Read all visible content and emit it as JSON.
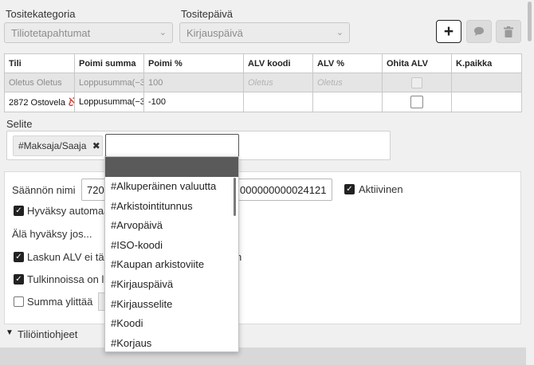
{
  "category": {
    "label": "Tositekategoria",
    "value": "Tiliotetapahtumat"
  },
  "date": {
    "label": "Tositepäivä",
    "value": "Kirjauspäivä"
  },
  "table": {
    "headers": [
      "Tili",
      "Poimi summa",
      "Poimi %",
      "ALV koodi",
      "ALV %",
      "Ohita ALV",
      "K.paikka"
    ],
    "row1": {
      "tili": "Oletus Oletus",
      "summa": "Loppusumma(−3",
      "pct": "100",
      "alv_koodi": "Oletus",
      "alv_pct": "Oletus"
    },
    "row2": {
      "tili": "2872 Ostovela",
      "summa": "Loppusumma(−3",
      "pct": "-100"
    }
  },
  "selite": {
    "label": "Selite",
    "tag": "#Maksaja/Saaja",
    "input_value": ""
  },
  "rule": {
    "name_label": "Säännön nimi",
    "name_value_start": "720",
    "name_value_end": "000000000024121",
    "active_label": "Aktiivinen",
    "auto_label": "Hyväksy automaa",
    "dont_accept_label": "Älä hyväksy jos...",
    "cond1": "Laskun ALV ei täs",
    "cond1_tail": "n",
    "cond2": "Tulkinnoissa on lis",
    "cond3": "Summa ylittää"
  },
  "section": {
    "label": "Tiliöintiohjeet"
  },
  "dropdown_options": [
    "#Alkuperäinen valuutta",
    "#Arkistointitunnus",
    "#Arvopäivä",
    "#ISO-koodi",
    "#Kaupan arkistoviite",
    "#Kirjauspäivä",
    "#Kirjausselite",
    "#Koodi",
    "#Korjaus"
  ],
  "colors": {
    "accent": "#222222",
    "row_disabled": "#e5e5e5",
    "highlight": "#5a5a5a"
  }
}
